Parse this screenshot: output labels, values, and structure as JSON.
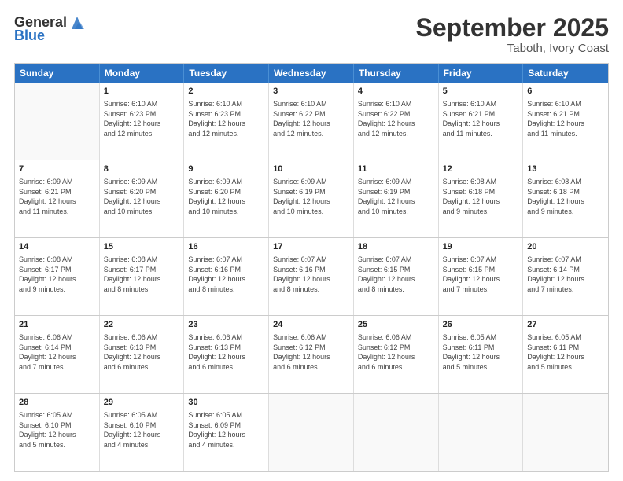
{
  "header": {
    "logo": {
      "line1": "General",
      "line2": "Blue"
    },
    "month": "September 2025",
    "location": "Taboth, Ivory Coast"
  },
  "days_of_week": [
    "Sunday",
    "Monday",
    "Tuesday",
    "Wednesday",
    "Thursday",
    "Friday",
    "Saturday"
  ],
  "weeks": [
    [
      {
        "day": "",
        "info": ""
      },
      {
        "day": "1",
        "info": "Sunrise: 6:10 AM\nSunset: 6:23 PM\nDaylight: 12 hours\nand 12 minutes."
      },
      {
        "day": "2",
        "info": "Sunrise: 6:10 AM\nSunset: 6:23 PM\nDaylight: 12 hours\nand 12 minutes."
      },
      {
        "day": "3",
        "info": "Sunrise: 6:10 AM\nSunset: 6:22 PM\nDaylight: 12 hours\nand 12 minutes."
      },
      {
        "day": "4",
        "info": "Sunrise: 6:10 AM\nSunset: 6:22 PM\nDaylight: 12 hours\nand 12 minutes."
      },
      {
        "day": "5",
        "info": "Sunrise: 6:10 AM\nSunset: 6:21 PM\nDaylight: 12 hours\nand 11 minutes."
      },
      {
        "day": "6",
        "info": "Sunrise: 6:10 AM\nSunset: 6:21 PM\nDaylight: 12 hours\nand 11 minutes."
      }
    ],
    [
      {
        "day": "7",
        "info": "Sunrise: 6:09 AM\nSunset: 6:21 PM\nDaylight: 12 hours\nand 11 minutes."
      },
      {
        "day": "8",
        "info": "Sunrise: 6:09 AM\nSunset: 6:20 PM\nDaylight: 12 hours\nand 10 minutes."
      },
      {
        "day": "9",
        "info": "Sunrise: 6:09 AM\nSunset: 6:20 PM\nDaylight: 12 hours\nand 10 minutes."
      },
      {
        "day": "10",
        "info": "Sunrise: 6:09 AM\nSunset: 6:19 PM\nDaylight: 12 hours\nand 10 minutes."
      },
      {
        "day": "11",
        "info": "Sunrise: 6:09 AM\nSunset: 6:19 PM\nDaylight: 12 hours\nand 10 minutes."
      },
      {
        "day": "12",
        "info": "Sunrise: 6:08 AM\nSunset: 6:18 PM\nDaylight: 12 hours\nand 9 minutes."
      },
      {
        "day": "13",
        "info": "Sunrise: 6:08 AM\nSunset: 6:18 PM\nDaylight: 12 hours\nand 9 minutes."
      }
    ],
    [
      {
        "day": "14",
        "info": "Sunrise: 6:08 AM\nSunset: 6:17 PM\nDaylight: 12 hours\nand 9 minutes."
      },
      {
        "day": "15",
        "info": "Sunrise: 6:08 AM\nSunset: 6:17 PM\nDaylight: 12 hours\nand 8 minutes."
      },
      {
        "day": "16",
        "info": "Sunrise: 6:07 AM\nSunset: 6:16 PM\nDaylight: 12 hours\nand 8 minutes."
      },
      {
        "day": "17",
        "info": "Sunrise: 6:07 AM\nSunset: 6:16 PM\nDaylight: 12 hours\nand 8 minutes."
      },
      {
        "day": "18",
        "info": "Sunrise: 6:07 AM\nSunset: 6:15 PM\nDaylight: 12 hours\nand 8 minutes."
      },
      {
        "day": "19",
        "info": "Sunrise: 6:07 AM\nSunset: 6:15 PM\nDaylight: 12 hours\nand 7 minutes."
      },
      {
        "day": "20",
        "info": "Sunrise: 6:07 AM\nSunset: 6:14 PM\nDaylight: 12 hours\nand 7 minutes."
      }
    ],
    [
      {
        "day": "21",
        "info": "Sunrise: 6:06 AM\nSunset: 6:14 PM\nDaylight: 12 hours\nand 7 minutes."
      },
      {
        "day": "22",
        "info": "Sunrise: 6:06 AM\nSunset: 6:13 PM\nDaylight: 12 hours\nand 6 minutes."
      },
      {
        "day": "23",
        "info": "Sunrise: 6:06 AM\nSunset: 6:13 PM\nDaylight: 12 hours\nand 6 minutes."
      },
      {
        "day": "24",
        "info": "Sunrise: 6:06 AM\nSunset: 6:12 PM\nDaylight: 12 hours\nand 6 minutes."
      },
      {
        "day": "25",
        "info": "Sunrise: 6:06 AM\nSunset: 6:12 PM\nDaylight: 12 hours\nand 6 minutes."
      },
      {
        "day": "26",
        "info": "Sunrise: 6:05 AM\nSunset: 6:11 PM\nDaylight: 12 hours\nand 5 minutes."
      },
      {
        "day": "27",
        "info": "Sunrise: 6:05 AM\nSunset: 6:11 PM\nDaylight: 12 hours\nand 5 minutes."
      }
    ],
    [
      {
        "day": "28",
        "info": "Sunrise: 6:05 AM\nSunset: 6:10 PM\nDaylight: 12 hours\nand 5 minutes."
      },
      {
        "day": "29",
        "info": "Sunrise: 6:05 AM\nSunset: 6:10 PM\nDaylight: 12 hours\nand 4 minutes."
      },
      {
        "day": "30",
        "info": "Sunrise: 6:05 AM\nSunset: 6:09 PM\nDaylight: 12 hours\nand 4 minutes."
      },
      {
        "day": "",
        "info": ""
      },
      {
        "day": "",
        "info": ""
      },
      {
        "day": "",
        "info": ""
      },
      {
        "day": "",
        "info": ""
      }
    ]
  ]
}
